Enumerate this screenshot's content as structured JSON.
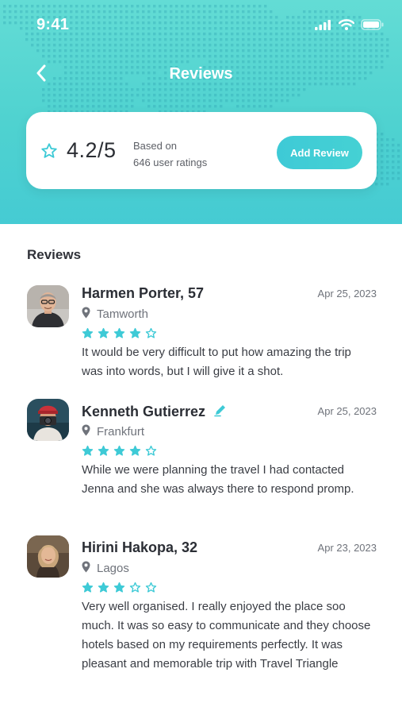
{
  "status_bar": {
    "time": "9:41",
    "icons": [
      "signal-icon",
      "wifi-icon",
      "battery-icon"
    ]
  },
  "header": {
    "title": "Reviews",
    "back_icon": "chevron-left-icon"
  },
  "rating_summary": {
    "score": "4.2/5",
    "based_on_line1": "Based on",
    "based_on_line2": "646 user ratings",
    "add_review_label": "Add Review"
  },
  "reviews_section": {
    "title": "Reviews",
    "items": [
      {
        "name": "Harmen Porter, 57",
        "date": "Apr 25, 2023",
        "location": "Tamworth",
        "rating": 4,
        "verified_edit_icon": false,
        "text": "It would be very difficult to put how amazing the trip was into words, but I will give it a shot."
      },
      {
        "name": "Kenneth Gutierrez",
        "date": "Apr 25, 2023",
        "location": "Frankfurt",
        "rating": 4,
        "verified_edit_icon": true,
        "text": "While we were planning the travel I had contacted Jenna and she was always there to respond promp."
      },
      {
        "name": "Hirini Hakopa, 32",
        "date": "Apr 23, 2023",
        "location": "Lagos",
        "rating": 3,
        "verified_edit_icon": false,
        "text": "Very well organised. I really enjoyed the place soo much. It was so easy to communicate and they choose hotels based on my requirements perfectly. It was pleasant and memorable trip with Travel Triangle"
      }
    ]
  },
  "colors": {
    "accent": "#3ecad6",
    "hero_top": "#63dcd5",
    "hero_bottom": "#45cbd3",
    "star": "#3ecad6"
  }
}
